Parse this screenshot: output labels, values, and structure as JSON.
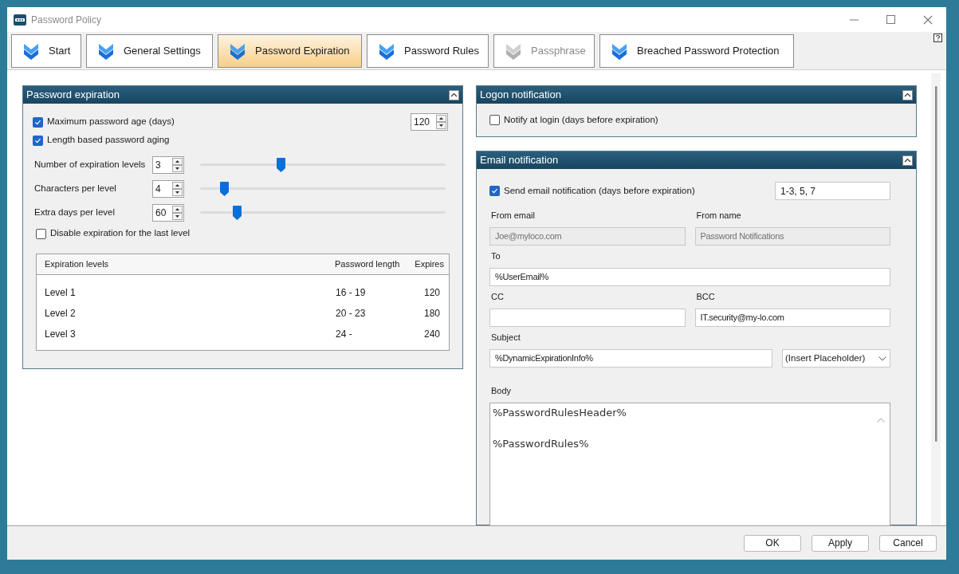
{
  "window": {
    "title": "Password Policy"
  },
  "tabs": [
    {
      "label": "Start",
      "selected": false,
      "disabled": false
    },
    {
      "label": "General Settings",
      "selected": false,
      "disabled": false
    },
    {
      "label": "Password Expiration",
      "selected": true,
      "disabled": false
    },
    {
      "label": "Password Rules",
      "selected": false,
      "disabled": false
    },
    {
      "label": "Passphrase",
      "selected": false,
      "disabled": true
    },
    {
      "label": "Breached Password Protection",
      "selected": false,
      "disabled": false
    }
  ],
  "expiration": {
    "title": "Password expiration",
    "max_age": {
      "label": "Maximum password age (days)",
      "checked": true,
      "value": "120"
    },
    "length_aging": {
      "label": "Length based password aging",
      "checked": true
    },
    "settings": [
      {
        "label": "Number of expiration levels",
        "value": "3",
        "level": 0.33
      },
      {
        "label": "Characters per level",
        "value": "4",
        "level": 0.1
      },
      {
        "label": "Extra days per level",
        "value": "60",
        "level": 0.15
      }
    ],
    "disable_last": {
      "label": "Disable expiration for the last level",
      "checked": false
    },
    "table": {
      "columns": [
        "Expiration levels",
        "Password length",
        "Expires"
      ],
      "rows": [
        [
          "Level 1",
          "16 - 19",
          "120"
        ],
        [
          "Level 2",
          "20 - 23",
          "180"
        ],
        [
          "Level 3",
          "24 -",
          "240"
        ]
      ]
    }
  },
  "logon": {
    "title": "Logon notification",
    "notify": {
      "label": "Notify at login (days before expiration)",
      "checked": false
    }
  },
  "email": {
    "title": "Email notification",
    "send": {
      "label": "Send email notification (days before expiration)",
      "checked": true,
      "value": "1-3, 5, 7"
    },
    "rows": [
      [
        {
          "kind": "text",
          "label": "From email",
          "value": "Joe@myloco.com",
          "disabled": true
        },
        {
          "kind": "text",
          "label": "From name",
          "value": "Password Notifications",
          "disabled": true
        }
      ],
      [
        {
          "kind": "text",
          "label": "To",
          "value": "%UserEmail%",
          "disabled": false
        }
      ],
      [
        {
          "kind": "text",
          "label": "CC",
          "disabled": false
        },
        {
          "kind": "text",
          "label": "BCC",
          "value": "IT.security@my-lo.com",
          "disabled": false
        }
      ],
      [
        {
          "kind": "text",
          "label": "Subject",
          "value": "%DynamicExpirationInfo%",
          "disabled": false
        },
        {
          "kind": "select",
          "value": "(Insert Placeholder)",
          "disabled": false
        }
      ]
    ],
    "body": {
      "label": "Body",
      "lines": [
        "%PasswordRulesHeader%",
        "%PasswordRules%"
      ]
    }
  },
  "buttons": [
    "OK",
    "Apply",
    "Cancel"
  ]
}
